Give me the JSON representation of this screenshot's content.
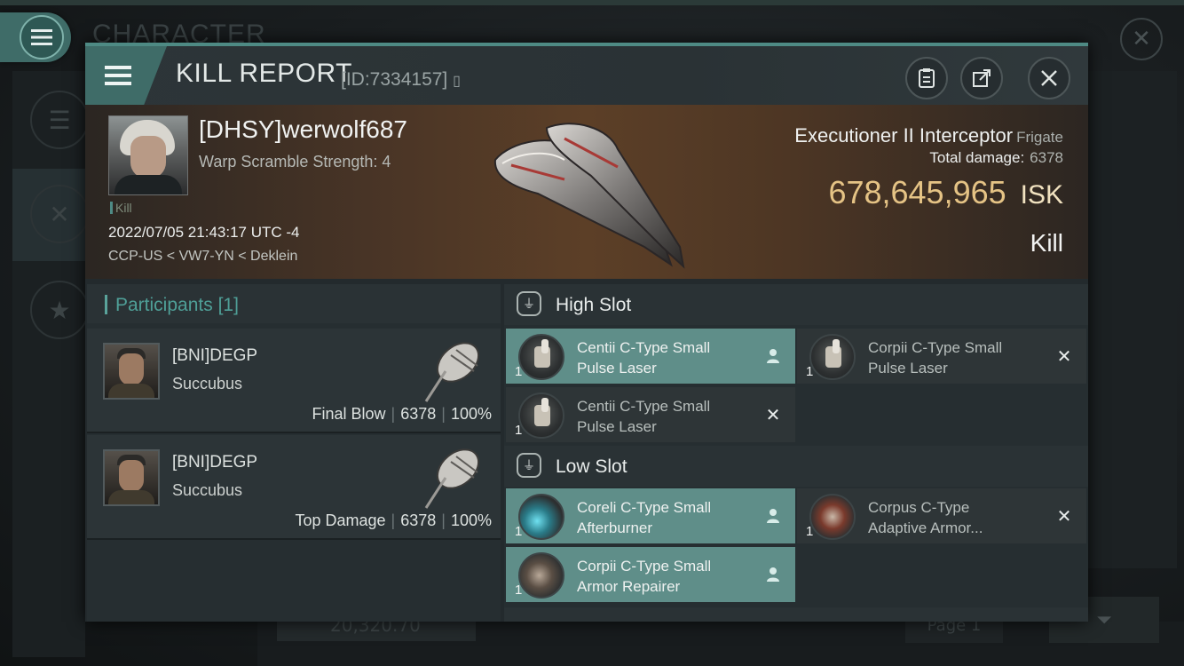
{
  "background": {
    "title": "CHARACTER",
    "wallet_value": "20,320.70",
    "page_label": "Page 1"
  },
  "window": {
    "title": "KILL REPORT",
    "id_label": "[ID:7334157]",
    "icons": [
      "menu-icon",
      "copy-icon",
      "clipboard-icon",
      "share-icon",
      "close-icon"
    ]
  },
  "victim": {
    "name": "[DHSY]werwolf687",
    "subtitle": "Warp Scramble Strength: 4",
    "tag": "Kill",
    "timestamp": "2022/07/05 21:43:17 UTC -4",
    "location": "CCP-US < VW7-YN < Deklein",
    "ship_name": "Executioner II Interceptor",
    "ship_class": "Frigate",
    "total_damage_label": "Total damage:",
    "total_damage_value": "6378",
    "isk_value": "678,645,965",
    "isk_unit": "ISK",
    "result_label": "Kill"
  },
  "participants": {
    "title": "Participants",
    "count": "[1]",
    "rows": [
      {
        "name": "[BNI]DEGP",
        "ship": "Succubus",
        "role": "Final Blow",
        "damage": "6378",
        "percent": "100%"
      },
      {
        "name": "[BNI]DEGP",
        "ship": "Succubus",
        "role": "Top Damage",
        "damage": "6378",
        "percent": "100%"
      }
    ]
  },
  "fitting": {
    "high_slot": {
      "title": "High Slot",
      "modules": [
        {
          "name_line1": "Centii C-Type Small",
          "name_line2": "Pulse Laser",
          "qty": "1",
          "status": "dropped"
        },
        {
          "name_line1": "Corpii C-Type Small",
          "name_line2": "Pulse Laser",
          "qty": "1",
          "status": "destroyed"
        },
        {
          "name_line1": "Centii C-Type Small",
          "name_line2": "Pulse Laser",
          "qty": "1",
          "status": "destroyed"
        }
      ]
    },
    "low_slot": {
      "title": "Low Slot",
      "modules": [
        {
          "name_line1": "Coreli C-Type Small",
          "name_line2": "Afterburner",
          "qty": "1",
          "status": "dropped"
        },
        {
          "name_line1": "Corpus C-Type",
          "name_line2": "Adaptive Armor...",
          "qty": "1",
          "status": "destroyed"
        },
        {
          "name_line1": "Corpii C-Type Small",
          "name_line2": "Armor Repairer",
          "qty": "1",
          "status": "dropped"
        }
      ]
    }
  },
  "colors": {
    "accent": "#5f8e89",
    "isk_gold": "#e5c385",
    "header_teal": "#3f6c68"
  }
}
